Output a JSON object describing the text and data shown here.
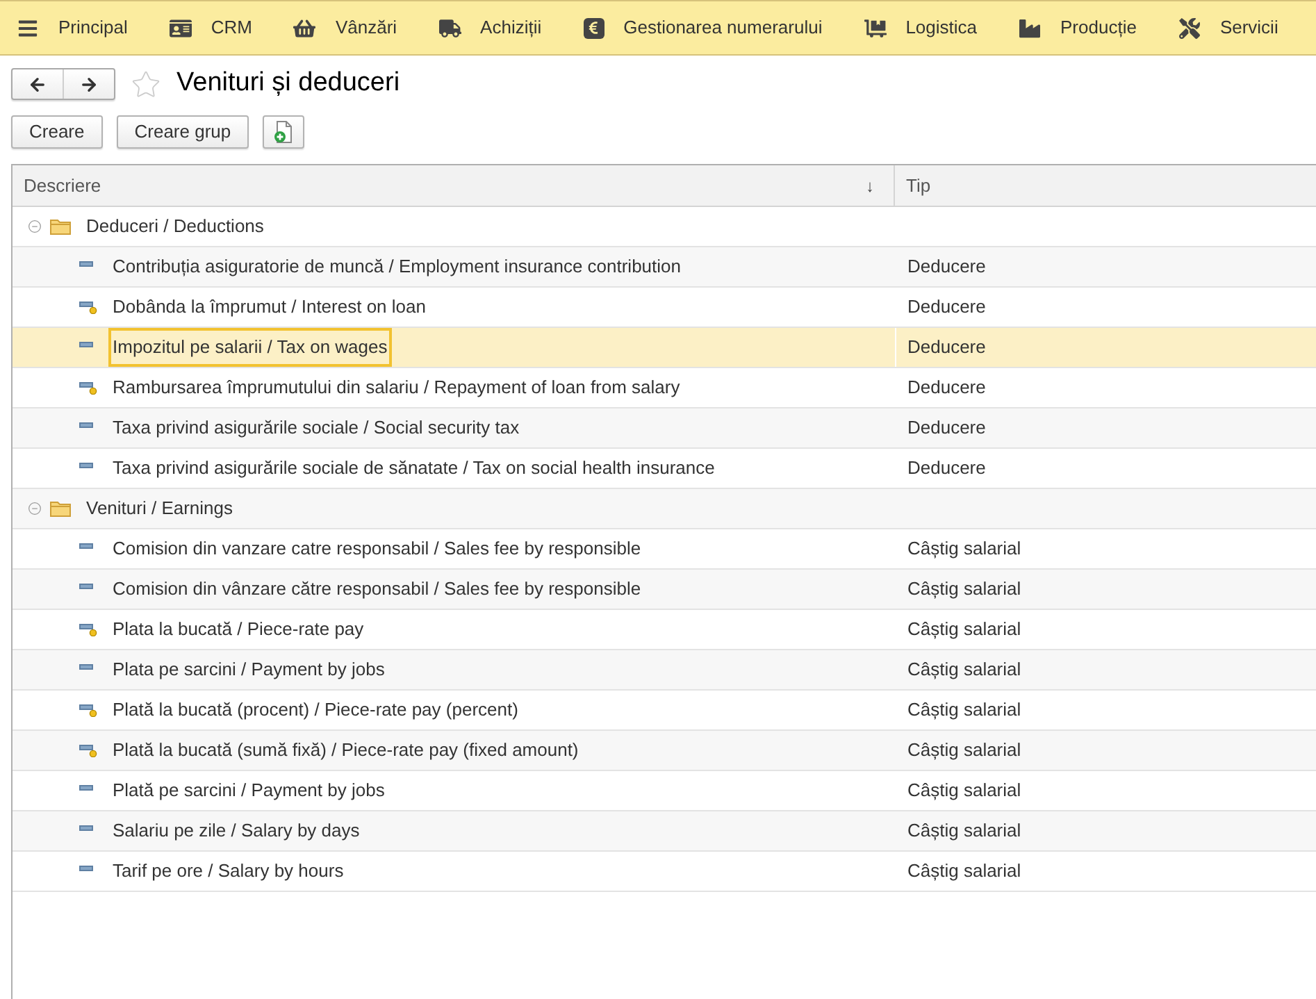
{
  "menu": [
    {
      "label": "Principal"
    },
    {
      "label": "CRM"
    },
    {
      "label": "Vânzări"
    },
    {
      "label": "Achiziții"
    },
    {
      "label": "Gestionarea numerarului"
    },
    {
      "label": "Logistica"
    },
    {
      "label": "Producție"
    },
    {
      "label": "Servicii"
    }
  ],
  "page": {
    "title": "Venituri și deduceri",
    "favorite": false
  },
  "toolbar": {
    "buttons": [
      {
        "kind": "text",
        "label": "Creare"
      },
      {
        "kind": "text",
        "label": "Creare grup"
      },
      {
        "kind": "icon"
      }
    ]
  },
  "table": {
    "columns": [
      {
        "label": "Descriere",
        "sort_indicator": "↓"
      },
      {
        "label": "Tip"
      }
    ],
    "groups": [
      {
        "label": "Deduceri / Deductions",
        "expanded": true,
        "selected": false,
        "children": [
          {
            "description": "Contribuția asiguratorie de muncă / Employment insurance contribution",
            "type": "Deducere",
            "kind": "plain",
            "selected": false
          },
          {
            "description": "Dobânda la împrumut / Interest on loan",
            "type": "Deducere",
            "kind": "flagged",
            "selected": false
          },
          {
            "description": "Impozitul pe salarii / Tax on wages",
            "type": "Deducere",
            "kind": "plain",
            "selected": true
          },
          {
            "description": "Rambursarea împrumutului din salariu / Repayment of loan from salary",
            "type": "Deducere",
            "kind": "flagged",
            "selected": false
          },
          {
            "description": "Taxa privind asigurările sociale / Social security tax",
            "type": "Deducere",
            "kind": "plain",
            "selected": false
          },
          {
            "description": "Taxa privind asigurările sociale de sănatate / Tax on social health insurance",
            "type": "Deducere",
            "kind": "plain",
            "selected": false
          }
        ]
      },
      {
        "label": "Venituri / Earnings",
        "expanded": true,
        "selected": false,
        "children": [
          {
            "description": "Comision din vanzare catre responsabil / Sales fee by responsible",
            "type": "Câștig salarial",
            "kind": "plain",
            "selected": false
          },
          {
            "description": "Comision din vânzare către responsabil / Sales fee by responsible",
            "type": "Câștig salarial",
            "kind": "plain",
            "selected": false
          },
          {
            "description": "Plata la bucată / Piece-rate pay",
            "type": "Câștig salarial",
            "kind": "flagged",
            "selected": false
          },
          {
            "description": "Plata pe sarcini / Payment by jobs",
            "type": "Câștig salarial",
            "kind": "plain",
            "selected": false
          },
          {
            "description": "Plată la bucată (procent) / Piece-rate pay (percent)",
            "type": "Câștig salarial",
            "kind": "flagged",
            "selected": false
          },
          {
            "description": "Plată la bucată (sumă fixă) / Piece-rate pay (fixed amount)",
            "type": "Câștig salarial",
            "kind": "flagged",
            "selected": false
          },
          {
            "description": "Plată pe sarcini / Payment by jobs",
            "type": "Câștig salarial",
            "kind": "plain",
            "selected": false
          },
          {
            "description": "Salariu pe zile / Salary by days",
            "type": "Câștig salarial",
            "kind": "plain",
            "selected": false
          },
          {
            "description": "Tarif pe ore / Salary by hours",
            "type": "Câștig salarial",
            "kind": "plain",
            "selected": false
          }
        ]
      }
    ]
  }
}
